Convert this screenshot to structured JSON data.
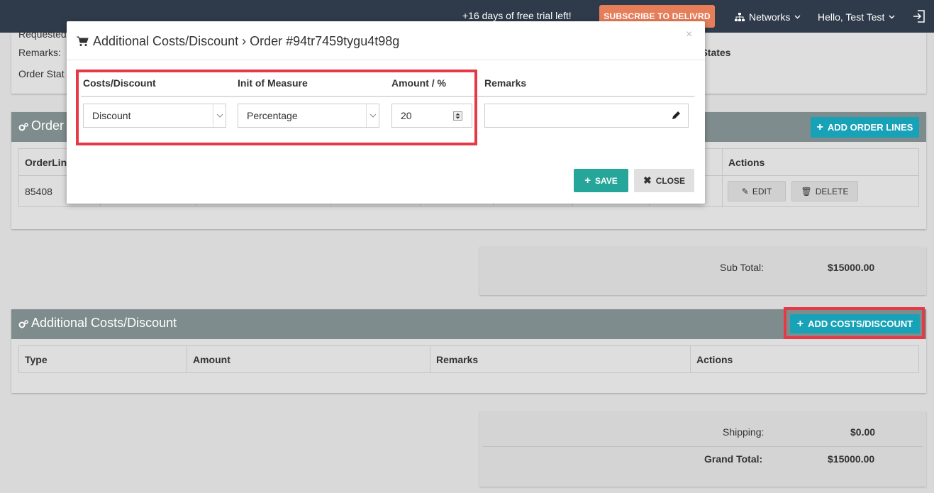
{
  "topbar": {
    "trial_text": "+16 days of free trial left!",
    "subscribe_label": "SUBSCRIBE TO DELIVRD",
    "networks_label": "Networks",
    "greeting": "Hello, Test Test"
  },
  "order_info": {
    "requested_label": "Requested",
    "remarks_label": "Remarks:",
    "order_status_label": "Order Stat",
    "country_fragment": "d States"
  },
  "order_lines": {
    "title": "Order",
    "add_button": "ADD ORDER LINES",
    "columns": [
      "OrderLin",
      "Actions"
    ],
    "rows": [
      {
        "id": "85408",
        "edit": "EDIT",
        "delete": "DELETE"
      }
    ]
  },
  "subtotal": {
    "label": "Sub Total:",
    "value": "$15000.00"
  },
  "costs": {
    "title": "Additional Costs/Discount",
    "add_button": "ADD COSTS/DISCOUNT",
    "columns": [
      "Type",
      "Amount",
      "Remarks",
      "Actions"
    ]
  },
  "totals": {
    "shipping_label": "Shipping:",
    "shipping_value": "$0.00",
    "grand_label": "Grand Total:",
    "grand_value": "$15000.00"
  },
  "modal": {
    "title": "Additional Costs/Discount › Order #94tr7459tygu4t98g",
    "close_x": "×",
    "headers": {
      "costs": "Costs/Discount",
      "unit": "Init of Measure",
      "amount": "Amount / %",
      "remarks": "Remarks"
    },
    "values": {
      "costs": "Discount",
      "unit": "Percentage",
      "amount": "20",
      "remarks": ""
    },
    "save_label": "SAVE",
    "close_label": "CLOSE"
  },
  "colors": {
    "topbar": "#2f3b4a",
    "accent_teal": "#17a2b8",
    "save_green": "#26a69a",
    "highlight_red": "#e53946",
    "subscribe": "#e67e5a"
  }
}
